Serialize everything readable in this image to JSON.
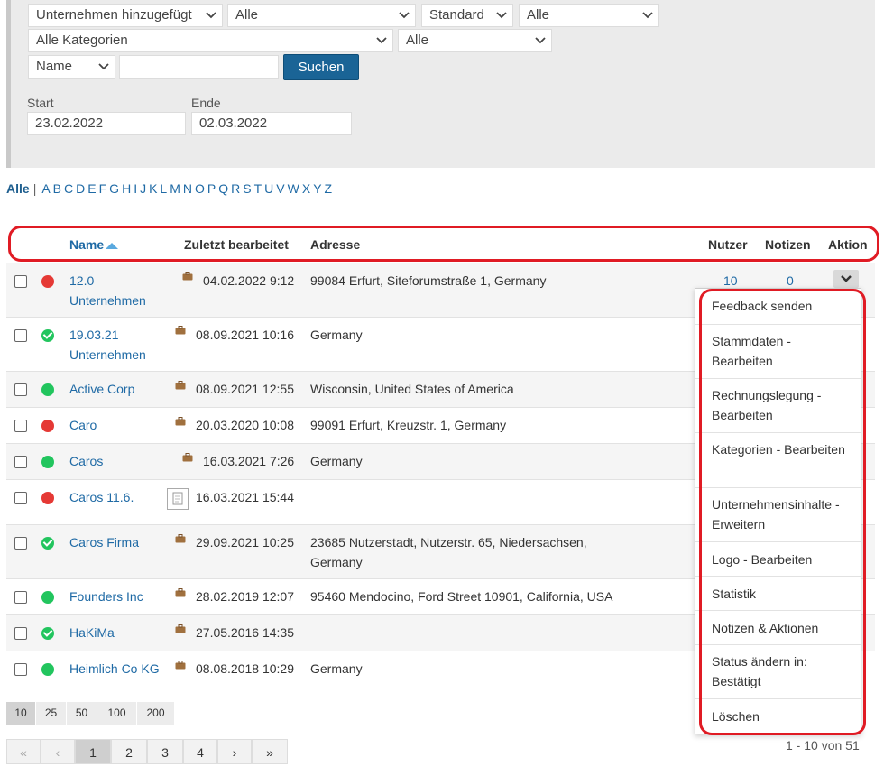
{
  "filters": {
    "row1": [
      "Unternehmen hinzugefügt",
      "Alle",
      "Standard",
      "Alle"
    ],
    "row2": [
      "Alle Kategorien",
      "Alle"
    ],
    "name_select": "Name",
    "search_value": "",
    "search_button": "Suchen",
    "start_label": "Start",
    "end_label": "Ende",
    "start_value": "23.02.2022",
    "end_value": "02.03.2022"
  },
  "alphabet": {
    "all": "Alle",
    "separator": "|",
    "letters": [
      "A",
      "B",
      "C",
      "D",
      "E",
      "F",
      "G",
      "H",
      "I",
      "J",
      "K",
      "L",
      "M",
      "N",
      "O",
      "P",
      "Q",
      "R",
      "S",
      "T",
      "U",
      "V",
      "W",
      "X",
      "Y",
      "Z"
    ]
  },
  "table": {
    "headers": {
      "name": "Name",
      "edited": "Zuletzt bearbeitet",
      "address": "Adresse",
      "users": "Nutzer",
      "notes": "Notizen",
      "action": "Aktion"
    },
    "rows": [
      {
        "status": "red",
        "name": "12.0 Unternehmen",
        "date": "04.02.2022 9:12",
        "address": "99084 Erfurt, Siteforumstraße 1, Germany",
        "users": "10",
        "notes": "0"
      },
      {
        "status": "check",
        "name": "19.03.21 Unternehmen",
        "date": "08.09.2021 10:16",
        "address": "Germany"
      },
      {
        "status": "green",
        "name": "Active Corp",
        "date": "08.09.2021 12:55",
        "address": "Wisconsin, United States of America"
      },
      {
        "status": "red",
        "name": "Caro",
        "date": "20.03.2020 10:08",
        "address": "99091 Erfurt, Kreuzstr. 1, Germany"
      },
      {
        "status": "green",
        "name": "Caros",
        "date": "16.03.2021 7:26",
        "address": "Germany"
      },
      {
        "status": "red",
        "name": "Caros 11.6.",
        "date": "16.03.2021 15:44",
        "address": ""
      },
      {
        "status": "check",
        "name": "Caros Firma",
        "date": "29.09.2021 10:25",
        "address": "23685 Nutzerstadt, Nutzerstr. 65, Niedersachsen, Germany"
      },
      {
        "status": "green",
        "name": "Founders Inc",
        "date": "28.02.2019 12:07",
        "address": "95460 Mendocino, Ford Street 10901, California, USA"
      },
      {
        "status": "check",
        "name": "HaKiMa",
        "date": "27.05.2016 14:35",
        "address": ""
      },
      {
        "status": "green",
        "name": "Heimlich Co KG",
        "date": "08.08.2018 10:29",
        "address": "Germany"
      }
    ]
  },
  "action_menu": [
    "Feedback senden",
    "Stammdaten - Bearbeiten",
    "Rechnungslegung - Bearbeiten",
    "Kategorien - Bearbeiten",
    "Unternehmensinhalte - Erweitern",
    "Logo - Bearbeiten",
    "Statistik",
    "Notizen & Aktionen",
    "Status ändern in: Bestätigt",
    "Löschen"
  ],
  "page_size": {
    "options": [
      "10",
      "25",
      "50",
      "100",
      "200"
    ],
    "selected": "10"
  },
  "pagination": {
    "first": "«",
    "prev": "‹",
    "pages": [
      "1",
      "2",
      "3",
      "4"
    ],
    "current": "1",
    "next": "›",
    "last": "»"
  },
  "result_count": "1 - 10 von 51",
  "colors": {
    "link": "#1f6aa5",
    "primary_button": "#1a6496",
    "status_red": "#e53935",
    "status_green": "#22c55e",
    "highlight": "#e01b24"
  }
}
